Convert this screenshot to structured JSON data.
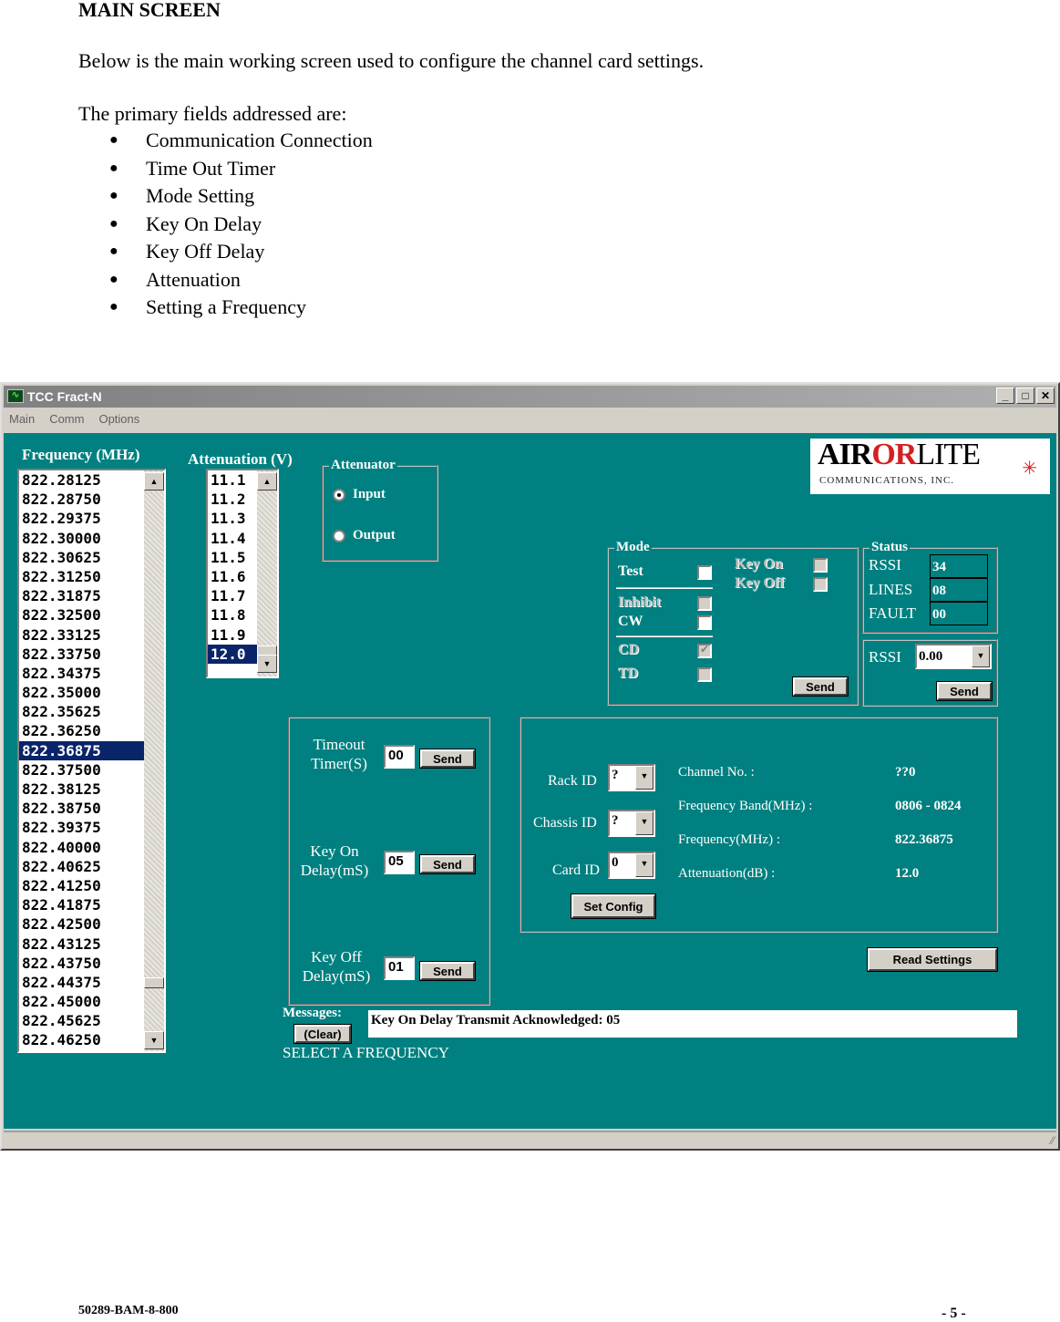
{
  "document": {
    "heading": "MAIN SCREEN",
    "intro": "Below is the main working screen used to configure the channel card settings.",
    "list_intro": "The primary fields addressed are:",
    "bullets": [
      "Communication Connection",
      "Time Out Timer",
      "Mode Setting",
      "Key On Delay",
      "Key Off Delay",
      "Attenuation",
      "Setting a Frequency"
    ],
    "footer_doc_id": "50289-BAM-8-800",
    "footer_page": "- 5 -"
  },
  "window": {
    "title": "TCC Fract-N",
    "app_icon": "oscilloscope-icon",
    "controls": {
      "minimize": "_",
      "maximize": "□",
      "close": "✕"
    },
    "menu": [
      "Main",
      "Comm",
      "Options"
    ]
  },
  "frequency": {
    "label": "Frequency (MHz)",
    "items": [
      "822.28125",
      "822.28750",
      "822.29375",
      "822.30000",
      "822.30625",
      "822.31250",
      "822.31875",
      "822.32500",
      "822.33125",
      "822.33750",
      "822.34375",
      "822.35000",
      "822.35625",
      "822.36250",
      "822.36875",
      "822.37500",
      "822.38125",
      "822.38750",
      "822.39375",
      "822.40000",
      "822.40625",
      "822.41250",
      "822.41875",
      "822.42500",
      "822.43125",
      "822.43750",
      "822.44375",
      "822.45000",
      "822.45625",
      "822.46250"
    ],
    "selected": "822.36875"
  },
  "attenuation": {
    "label": "Attenuation (V)",
    "items": [
      "11.1",
      "11.2",
      "11.3",
      "11.4",
      "11.5",
      "11.6",
      "11.7",
      "11.8",
      "11.9",
      "12.0"
    ],
    "selected": "12.0"
  },
  "attenuator": {
    "title": "Attenuator",
    "options": [
      {
        "label": "Input",
        "checked": true
      },
      {
        "label": "Output",
        "checked": false
      }
    ]
  },
  "logo": {
    "name": "AIRORLITE",
    "part1": "AIR",
    "part2": "OR",
    "part3": "LITE",
    "subtitle": "COMMUNICATIONS, INC.",
    "accent": "#d42020"
  },
  "mode": {
    "title": "Mode",
    "test": {
      "label": "Test",
      "checked": false,
      "enabled": true
    },
    "inhibit": {
      "label": "Inhibit",
      "checked": false,
      "enabled": false
    },
    "cw": {
      "label": "CW",
      "checked": false,
      "enabled": true
    },
    "cd": {
      "label": "CD",
      "checked": true,
      "enabled": false
    },
    "td": {
      "label": "TD",
      "checked": false,
      "enabled": false
    },
    "key_on": {
      "label": "Key On",
      "checked": false,
      "enabled": false
    },
    "key_off": {
      "label": "Key Off",
      "checked": false,
      "enabled": false
    },
    "send": "Send"
  },
  "status": {
    "title": "Status",
    "rows": [
      {
        "label": "RSSI",
        "value": "34"
      },
      {
        "label": "LINES",
        "value": "08"
      },
      {
        "label": "FAULT",
        "value": "00"
      }
    ]
  },
  "rssi": {
    "label": "RSSI",
    "value": "0.00",
    "send": "Send"
  },
  "timers": {
    "timeout": {
      "label1": "Timeout",
      "label2": "Timer(S)",
      "value": "00",
      "send": "Send"
    },
    "key_on": {
      "label1": "Key On",
      "label2": "Delay(mS)",
      "value": "05",
      "send": "Send"
    },
    "key_off": {
      "label1": "Key Off",
      "label2": "Delay(mS)",
      "value": "01",
      "send": "Send"
    }
  },
  "config": {
    "rack": {
      "label": "Rack ID",
      "value": "?"
    },
    "chassis": {
      "label": "Chassis ID",
      "value": "?"
    },
    "card": {
      "label": "Card ID",
      "value": "0"
    },
    "set_config": "Set Config",
    "info": [
      {
        "key": "Channel No. :",
        "value": "??0"
      },
      {
        "key": "Frequency Band(MHz) :",
        "value": "0806  - 0824"
      },
      {
        "key": "Frequency(MHz) :",
        "value": "822.36875"
      },
      {
        "key": "Attenuation(dB) :",
        "value": "12.0"
      }
    ]
  },
  "read_settings": "Read Settings",
  "messages": {
    "label": "Messages:",
    "clear": "(Clear)",
    "text": "Key On Delay Transmit Acknowledged: 05",
    "hint": "SELECT A FREQUENCY"
  },
  "colors": {
    "client_bg": "#008080",
    "selection": "#0a246a",
    "chrome": "#d4d0c8"
  }
}
